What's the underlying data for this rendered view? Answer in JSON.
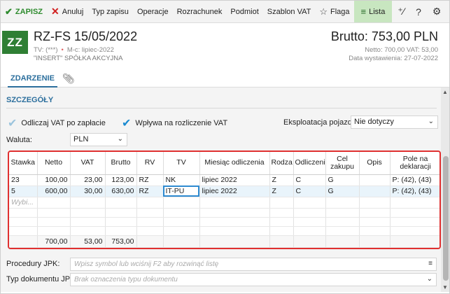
{
  "toolbar": {
    "save": "ZAPISZ",
    "cancel": "Anuluj",
    "type": "Typ zapisu",
    "operations": "Operacje",
    "settlement": "Rozrachunek",
    "entity": "Podmiot",
    "vat_template": "Szablon VAT",
    "flag": "Flaga",
    "list": "Lista"
  },
  "header": {
    "avatar": "ZZ",
    "title": "RZ-FS 15/05/2022",
    "tv": "TV: (***)",
    "month": "M-c: lipiec-2022",
    "company": "\"INSERT\" SPÓŁKA AKCYJNA",
    "gross": "Brutto: 753,00 PLN",
    "net_vat": "Netto: 700,00 VAT: 53,00",
    "issue_date": "Data wystawienia: 27-07-2022"
  },
  "tabs": {
    "main": "ZDARZENIE"
  },
  "details": {
    "section_title": "SZCZEGÓŁY",
    "deduct_vat": "Odliczaj VAT po zapłacie",
    "affects_vat": "Wpływa na rozliczenie VAT",
    "vehicle_label": "Eksploatacja pojazdu:",
    "vehicle_value": "Nie dotyczy",
    "currency_label": "Waluta:",
    "currency_value": "PLN"
  },
  "grid": {
    "headers": [
      "Stawka",
      "Netto",
      "VAT",
      "Brutto",
      "RV",
      "TV",
      "Miesiąc odliczenia",
      "Rodza",
      "Odliczeni",
      "Cel zakupu",
      "Opis",
      "Pole na deklaracji"
    ],
    "rows": [
      [
        "23",
        "100,00",
        "23,00",
        "123,00",
        "RZ",
        "NK",
        "lipiec 2022",
        "Z",
        "C",
        "G",
        "",
        "P: (42), (43)"
      ],
      [
        "5",
        "600,00",
        "30,00",
        "630,00",
        "RZ",
        "IT-PU",
        "lipiec 2022",
        "Z",
        "C",
        "G",
        "",
        "P: (42), (43)"
      ]
    ],
    "new_row_placeholder": "Wybi...",
    "totals": [
      "",
      "700,00",
      "53,00",
      "753,00",
      "",
      "",
      "",
      "",
      "",
      "",
      "",
      ""
    ]
  },
  "jpk": {
    "procedures_label": "Procedury JPK:",
    "procedures_placeholder": "Wpisz symbol lub wciśnij F2 aby rozwinąć listę",
    "doc_type_label": "Typ dokumentu JPK:",
    "doc_type_placeholder": "Brak oznaczenia typu dokumentu"
  }
}
